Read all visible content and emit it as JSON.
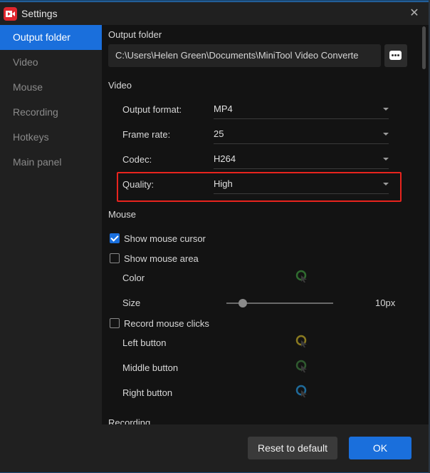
{
  "window": {
    "title": "Settings",
    "close_label": "✕"
  },
  "sidebar": {
    "items": [
      {
        "label": "Output folder",
        "active": true
      },
      {
        "label": "Video"
      },
      {
        "label": "Mouse"
      },
      {
        "label": "Recording"
      },
      {
        "label": "Hotkeys"
      },
      {
        "label": "Main panel"
      }
    ]
  },
  "output_folder": {
    "heading": "Output folder",
    "path": "C:\\Users\\Helen Green\\Documents\\MiniTool Video Converte"
  },
  "video": {
    "heading": "Video",
    "output_format": {
      "label": "Output format:",
      "value": "MP4"
    },
    "frame_rate": {
      "label": "Frame rate:",
      "value": "25"
    },
    "codec": {
      "label": "Codec:",
      "value": "H264"
    },
    "quality": {
      "label": "Quality:",
      "value": "High"
    }
  },
  "mouse": {
    "heading": "Mouse",
    "show_cursor": {
      "label": "Show mouse cursor",
      "checked": true
    },
    "show_area": {
      "label": "Show mouse area",
      "checked": false
    },
    "color_label": "Color",
    "size_label": "Size",
    "size_value": "10px",
    "size_fraction": 0.15,
    "record_clicks": {
      "label": "Record mouse clicks",
      "checked": false
    },
    "left_button": "Left button",
    "middle_button": "Middle button",
    "right_button": "Right button",
    "colors": {
      "area": "#2f6b2f",
      "left": "#8a7a20",
      "middle": "#2f5a2f",
      "right": "#1f6a9a"
    }
  },
  "recording": {
    "heading": "Recording"
  },
  "footer": {
    "reset_label": "Reset to default",
    "ok_label": "OK"
  }
}
